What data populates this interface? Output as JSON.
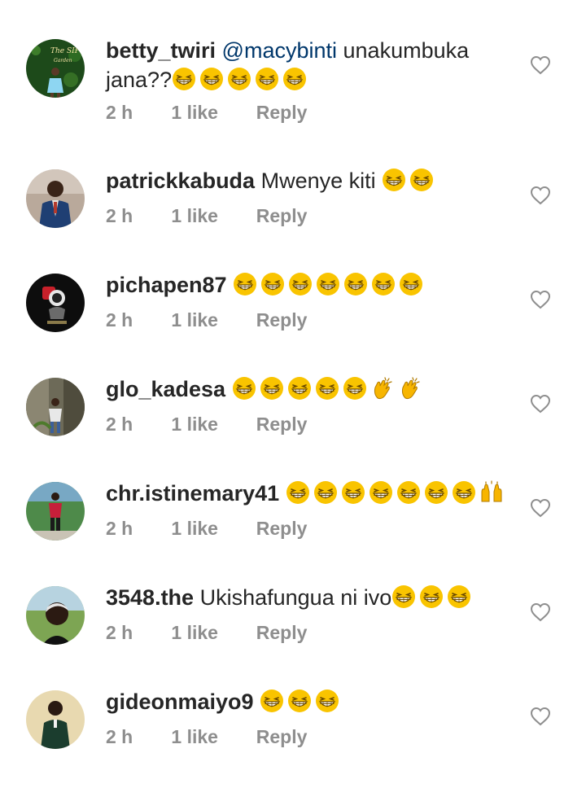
{
  "comments": [
    {
      "username": "betty_twiri",
      "mention": "@macybinti",
      "text_line1": "unakumbuka",
      "text_line2": "jana??",
      "emojis": [
        "grin",
        "grin",
        "grin",
        "grin",
        "grin"
      ],
      "time": "2 h",
      "likes": "1 like",
      "reply": "Reply",
      "avatar_label": "The SIP",
      "avatar_label2": "Garden"
    },
    {
      "username": "patrickkabuda",
      "text": "Mwenye kiti",
      "emojis": [
        "grin",
        "grin"
      ],
      "time": "2 h",
      "likes": "1 like",
      "reply": "Reply"
    },
    {
      "username": "pichapen87",
      "text": "",
      "emojis": [
        "grin",
        "grin",
        "grin",
        "grin",
        "grin",
        "grin",
        "grin"
      ],
      "time": "2 h",
      "likes": "1 like",
      "reply": "Reply"
    },
    {
      "username": "glo_kadesa",
      "text": "",
      "emojis": [
        "grin",
        "grin",
        "grin",
        "grin",
        "grin",
        "clap",
        "clap"
      ],
      "time": "2 h",
      "likes": "1 like",
      "reply": "Reply"
    },
    {
      "username": "chr.istinemary41",
      "text": "",
      "emojis": [
        "grin",
        "grin",
        "grin",
        "grin",
        "grin",
        "grin",
        "grin",
        "raised-hands"
      ],
      "time": "2 h",
      "likes": "1 like",
      "reply": "Reply"
    },
    {
      "username": "3548.the",
      "text": "Ukishafungua ni ivo",
      "emojis": [
        "grin",
        "grin",
        "grin"
      ],
      "time": "2 h",
      "likes": "1 like",
      "reply": "Reply"
    },
    {
      "username": "gideonmaiyo9",
      "text": "",
      "emojis": [
        "grin",
        "grin",
        "grin"
      ],
      "time": "2 h",
      "likes": "1 like",
      "reply": "Reply"
    }
  ],
  "icons": {
    "like": "heart-outline-icon",
    "grin": "grinning-squinting-face-emoji",
    "clap": "clapping-hands-emoji",
    "raised": "raising-hands-emoji"
  },
  "colors": {
    "username": "#262626",
    "mention": "#00376b",
    "meta": "#8e8e8e",
    "emoji_yellow": "#f9c400"
  }
}
